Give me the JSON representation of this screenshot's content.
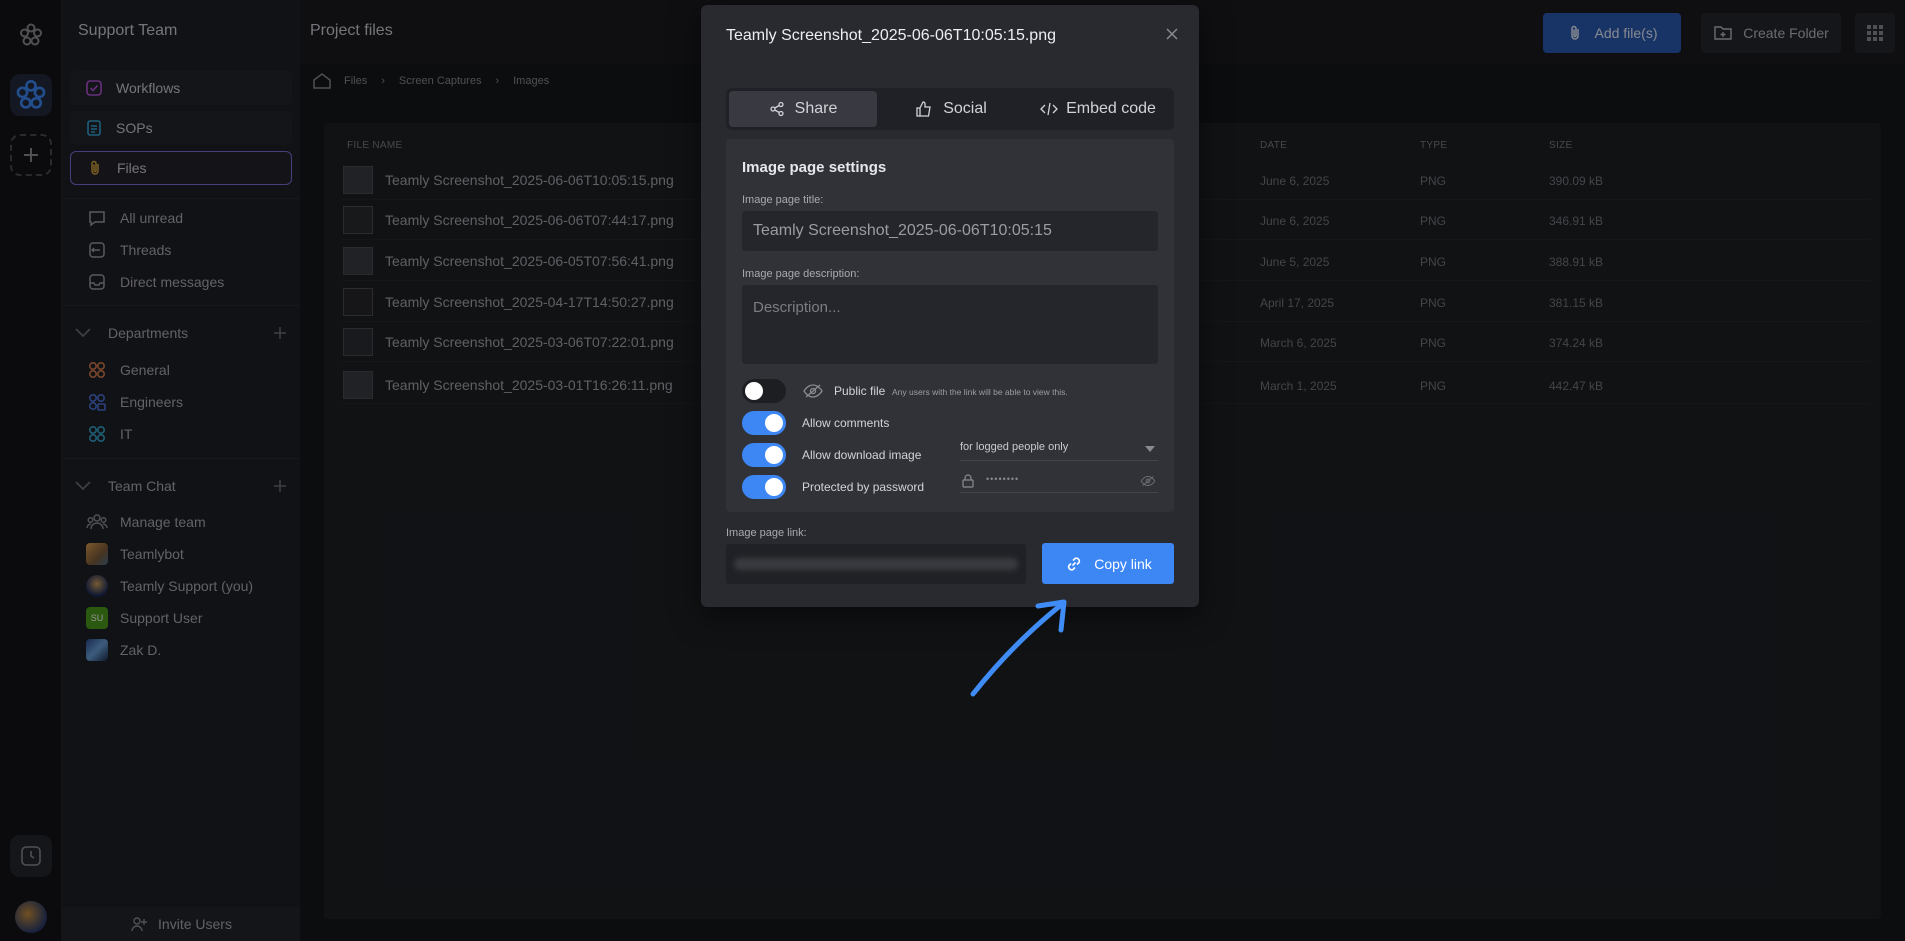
{
  "workspace": {
    "name": "Support Team"
  },
  "sidebar": {
    "primary": [
      {
        "label": "Workflows",
        "icon": "workflow-icon"
      },
      {
        "label": "SOPs",
        "icon": "sop-icon"
      },
      {
        "label": "Files",
        "icon": "paperclip-icon"
      }
    ],
    "inbox": [
      {
        "label": "All unread",
        "icon": "chat-bubble-icon"
      },
      {
        "label": "Threads",
        "icon": "threads-icon"
      },
      {
        "label": "Direct messages",
        "icon": "inbox-icon"
      }
    ],
    "departments": {
      "title": "Departments",
      "items": [
        {
          "label": "General"
        },
        {
          "label": "Engineers"
        },
        {
          "label": "IT"
        }
      ]
    },
    "team_chat": {
      "title": "Team Chat",
      "items": [
        {
          "label": "Manage team"
        },
        {
          "label": "Teamlybot"
        },
        {
          "label": "Teamly Support (you)"
        },
        {
          "label": "Support User",
          "initials": "SU"
        },
        {
          "label": "Zak D."
        }
      ]
    },
    "invite": "Invite Users"
  },
  "header": {
    "title": "Project files",
    "add_files": "Add file(s)",
    "create_folder": "Create Folder"
  },
  "breadcrumb": [
    "Files",
    "Screen Captures",
    "Images"
  ],
  "table": {
    "columns": [
      "FILE NAME",
      "DATE",
      "TYPE",
      "SIZE"
    ],
    "rows": [
      {
        "name": "Teamly Screenshot_2025-06-06T10:05:15.png",
        "date": "June 6, 2025",
        "type": "PNG",
        "size": "390.09 kB"
      },
      {
        "name": "Teamly Screenshot_2025-06-06T07:44:17.png",
        "date": "June 6, 2025",
        "type": "PNG",
        "size": "346.91 kB"
      },
      {
        "name": "Teamly Screenshot_2025-06-05T07:56:41.png",
        "date": "June 5, 2025",
        "type": "PNG",
        "size": "388.91 kB"
      },
      {
        "name": "Teamly Screenshot_2025-04-17T14:50:27.png",
        "date": "April 17, 2025",
        "type": "PNG",
        "size": "381.15 kB"
      },
      {
        "name": "Teamly Screenshot_2025-03-06T07:22:01.png",
        "date": "March 6, 2025",
        "type": "PNG",
        "size": "374.24 kB"
      },
      {
        "name": "Teamly Screenshot_2025-03-01T16:26:11.png",
        "date": "March 1, 2025",
        "type": "PNG",
        "size": "442.47 kB"
      }
    ]
  },
  "modal": {
    "title": "Teamly Screenshot_2025-06-06T10:05:15.png",
    "tabs": [
      "Share",
      "Social",
      "Embed code"
    ],
    "settings_title": "Image page settings",
    "page_title_label": "Image page title:",
    "page_title_value": "Teamly Screenshot_2025-06-06T10:05:15",
    "description_label": "Image page description:",
    "description_placeholder": "Description...",
    "public_file_label": "Public file",
    "public_file_hint": "Any users with the link will be able to view this.",
    "public_file_on": false,
    "allow_comments_label": "Allow comments",
    "allow_comments_on": true,
    "allow_download_label": "Allow download image",
    "allow_download_on": true,
    "download_option": "for logged people only",
    "password_label": "Protected by password",
    "password_on": true,
    "password_mask": "••••••••",
    "link_label": "Image page link:",
    "copy_link": "Copy link"
  },
  "colors": {
    "accent": "#3d87f5",
    "arrow": "#3f8cf6"
  }
}
